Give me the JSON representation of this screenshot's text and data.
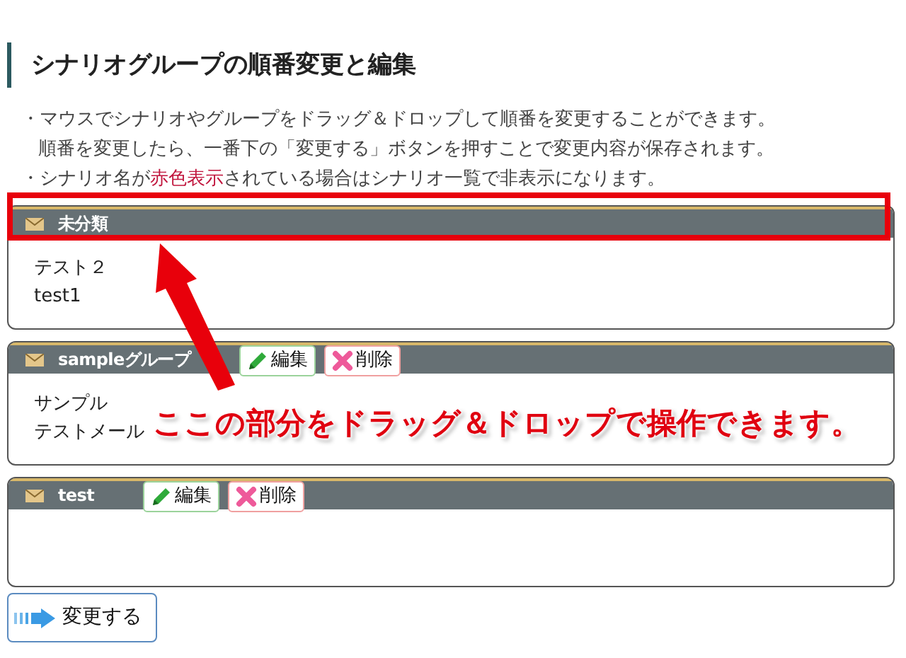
{
  "heading": "シナリオグループの順番変更と編集",
  "notes": [
    {
      "lines": [
        [
          {
            "text": "・マウスでシナリオやグループをドラッグ＆ドロップして順番を変更することができます。",
            "kind": "plain"
          }
        ],
        [
          {
            "text": "順番を変更したら、一番下の「変更する」ボタンを押すことで変更内容が保存されます。",
            "kind": "plain"
          }
        ]
      ]
    },
    {
      "lines": [
        [
          {
            "text": "・シナリオ名が",
            "kind": "plain"
          },
          {
            "text": "赤色表示",
            "kind": "red"
          },
          {
            "text": "されている場合はシナリオ一覧で非表示になります。",
            "kind": "plain"
          }
        ]
      ]
    }
  ],
  "groups": [
    {
      "name": "未分類",
      "items": [
        "テスト２",
        "test1"
      ]
    },
    {
      "name": "sampleグループ",
      "buttons": [
        {
          "label": "編集",
          "kind": "edit"
        },
        {
          "label": "削除",
          "kind": "delete"
        }
      ],
      "items": [
        "サンプル",
        "テストメール"
      ]
    },
    {
      "name": "test",
      "buttons": [
        {
          "label": "編集",
          "kind": "edit"
        },
        {
          "label": "削除",
          "kind": "delete"
        }
      ]
    }
  ],
  "save_button": "変更する",
  "annotation": {
    "text": "ここの部分をドラッグ＆ドロップで操作できます。"
  }
}
